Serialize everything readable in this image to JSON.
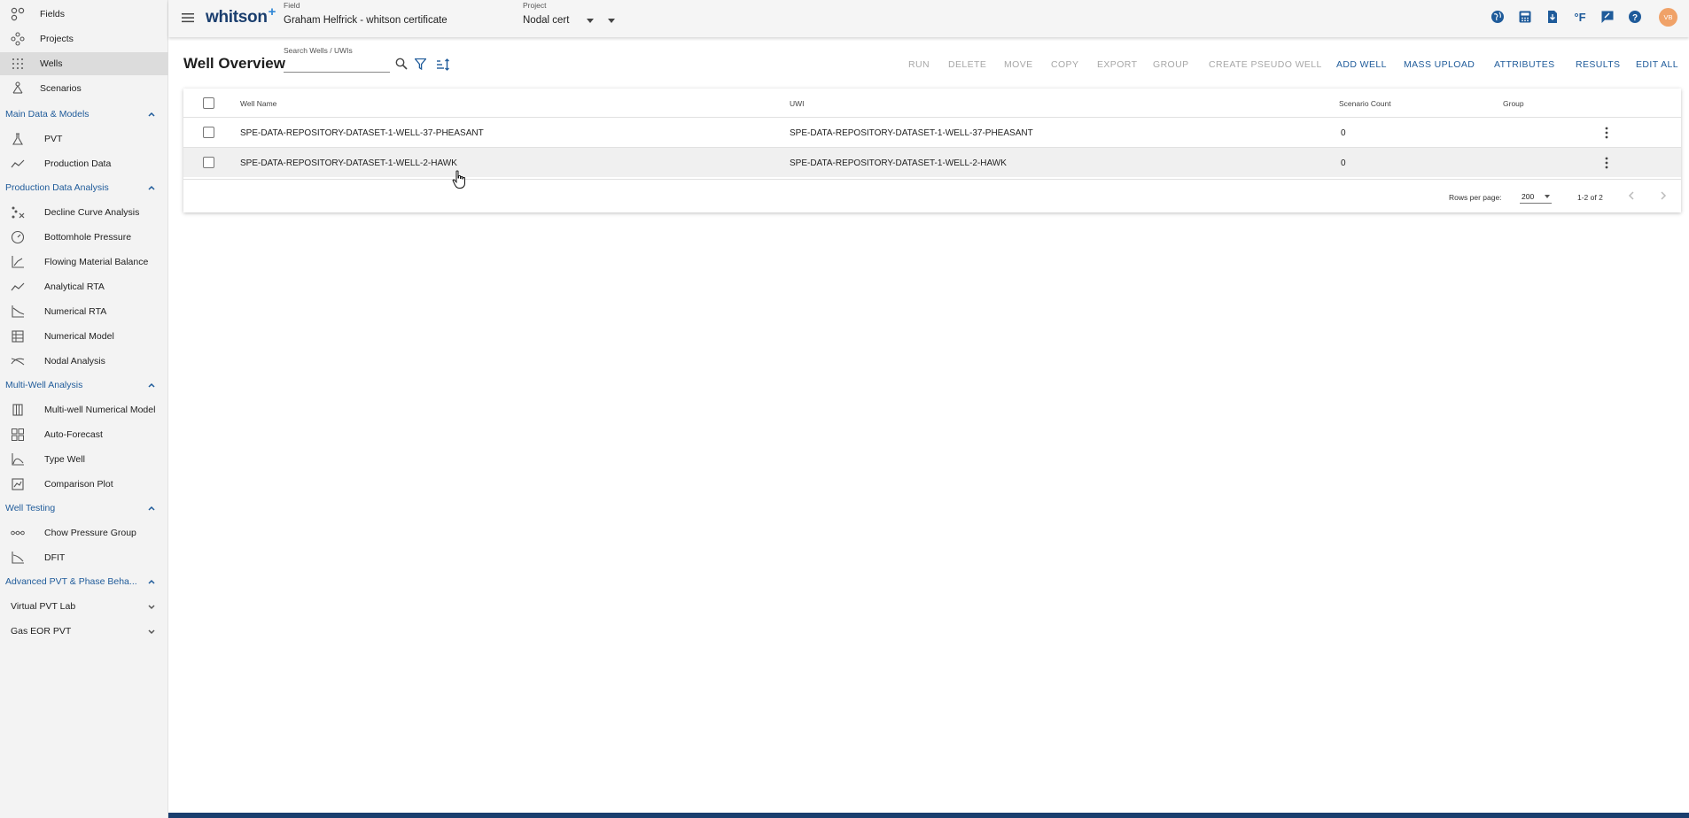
{
  "sidebar": {
    "top_items": [
      {
        "label": "Fields",
        "icon": "fields-icon"
      },
      {
        "label": "Projects",
        "icon": "projects-icon"
      },
      {
        "label": "Wells",
        "icon": "wells-icon",
        "active": true
      },
      {
        "label": "Scenarios",
        "icon": "scenarios-icon"
      }
    ],
    "sections": [
      {
        "title": "Main Data & Models",
        "items": [
          {
            "label": "PVT"
          },
          {
            "label": "Production Data"
          }
        ]
      },
      {
        "title": "Production Data Analysis",
        "items": [
          {
            "label": "Decline Curve Analysis"
          },
          {
            "label": "Bottomhole Pressure"
          },
          {
            "label": "Flowing Material Balance"
          },
          {
            "label": "Analytical RTA"
          },
          {
            "label": "Numerical RTA"
          },
          {
            "label": "Numerical Model"
          },
          {
            "label": "Nodal Analysis"
          }
        ]
      },
      {
        "title": "Multi-Well Analysis",
        "items": [
          {
            "label": "Multi-well Numerical Model"
          },
          {
            "label": "Auto-Forecast"
          },
          {
            "label": "Type Well"
          },
          {
            "label": "Comparison Plot"
          }
        ]
      },
      {
        "title": "Well Testing",
        "items": [
          {
            "label": "Chow Pressure Group"
          },
          {
            "label": "DFIT"
          }
        ]
      },
      {
        "title": "Advanced PVT & Phase Beha...",
        "items": []
      }
    ],
    "expandables": [
      {
        "label": "Virtual PVT Lab"
      },
      {
        "label": "Gas EOR PVT"
      }
    ]
  },
  "header": {
    "logo": "whitson",
    "logo_plus": "+",
    "field_caption": "Field",
    "field_value": "Graham Helfrick - whitson certificate",
    "project_caption": "Project",
    "project_value": "Nodal cert",
    "temp_unit": "°F",
    "avatar_initials": "VB"
  },
  "toolbar": {
    "title": "Well Overview",
    "search_caption": "Search Wells / UWIs",
    "search_value": "",
    "buttons": [
      {
        "label": "RUN",
        "enabled": false
      },
      {
        "label": "DELETE",
        "enabled": false
      },
      {
        "label": "MOVE",
        "enabled": false
      },
      {
        "label": "COPY",
        "enabled": false
      },
      {
        "label": "EXPORT",
        "enabled": false
      },
      {
        "label": "GROUP",
        "enabled": false
      },
      {
        "label": "CREATE PSEUDO WELL",
        "enabled": false
      },
      {
        "label": "ADD WELL",
        "enabled": true
      },
      {
        "label": "MASS UPLOAD",
        "enabled": true
      },
      {
        "label": "ATTRIBUTES",
        "enabled": true
      },
      {
        "label": "RESULTS",
        "enabled": true
      },
      {
        "label": "EDIT ALL",
        "enabled": true
      }
    ]
  },
  "table": {
    "columns": [
      "Well Name",
      "UWI",
      "Scenario Count",
      "Group"
    ],
    "rows": [
      {
        "well_name": "SPE-DATA-REPOSITORY-DATASET-1-WELL-37-PHEASANT",
        "uwi": "SPE-DATA-REPOSITORY-DATASET-1-WELL-37-PHEASANT",
        "scenario_count": "0",
        "group": ""
      },
      {
        "well_name": "SPE-DATA-REPOSITORY-DATASET-1-WELL-2-HAWK",
        "uwi": "SPE-DATA-REPOSITORY-DATASET-1-WELL-2-HAWK",
        "scenario_count": "0",
        "group": ""
      }
    ],
    "rows_per_page_label": "Rows per page:",
    "rows_per_page": "200",
    "range": "1-2 of 2"
  },
  "colors": {
    "accent": "#1f5b9a",
    "brand_dark": "#1a3e6e",
    "avatar": "#f0a268"
  }
}
